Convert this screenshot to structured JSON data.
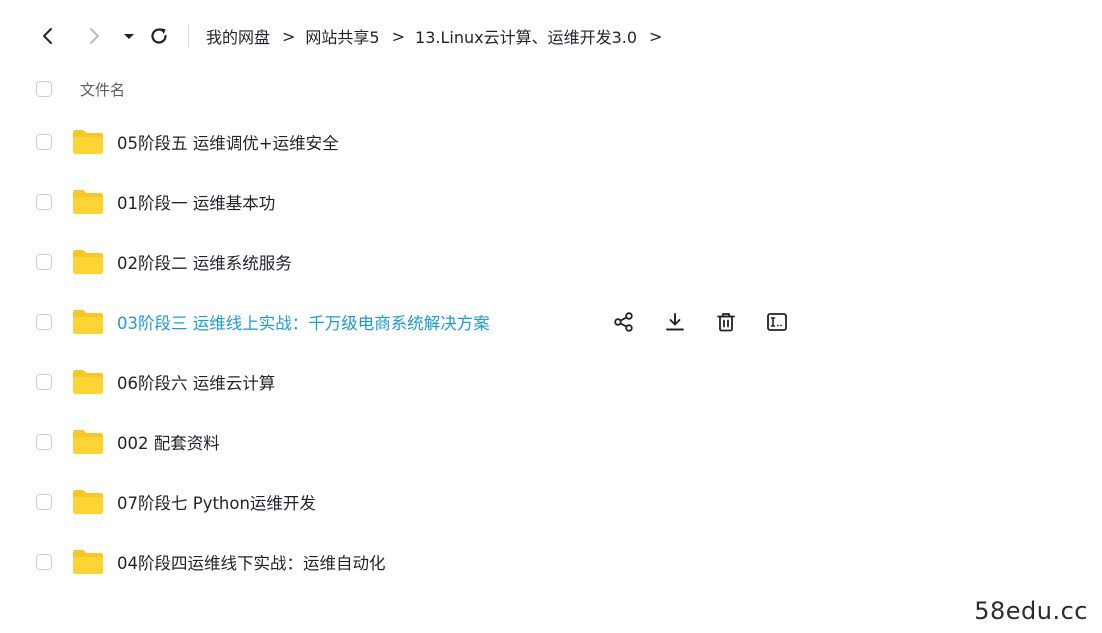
{
  "breadcrumb": [
    "我的网盘",
    "网站共享5",
    "13.Linux云计算、运维开发3.0"
  ],
  "breadcrumb_separator": ">",
  "list_header": {
    "name_column": "文件名"
  },
  "files": [
    {
      "name": "05阶段五 运维调优+运维安全",
      "type": "folder",
      "hovered": false
    },
    {
      "name": "01阶段一 运维基本功",
      "type": "folder",
      "hovered": false
    },
    {
      "name": "02阶段二 运维系统服务",
      "type": "folder",
      "hovered": false
    },
    {
      "name": "03阶段三 运维线上实战：千万级电商系统解决方案",
      "type": "folder",
      "hovered": true
    },
    {
      "name": "06阶段六 运维云计算",
      "type": "folder",
      "hovered": false
    },
    {
      "name": "002 配套资料",
      "type": "folder",
      "hovered": false
    },
    {
      "name": "07阶段七 Python运维开发",
      "type": "folder",
      "hovered": false
    },
    {
      "name": "04阶段四运维线下实战：运维自动化",
      "type": "folder",
      "hovered": false
    }
  ],
  "row_actions": [
    "share-icon",
    "download-icon",
    "delete-icon",
    "rename-icon"
  ],
  "icons": {
    "back": "chevron-left-icon",
    "forward": "chevron-right-icon",
    "history": "caret-down-icon",
    "refresh": "refresh-icon",
    "folder": "folder-icon"
  },
  "colors": {
    "folder": "#f8c62b",
    "hover_text": "#1d9bd7",
    "text": "#1f2329",
    "muted": "#5a5f66"
  },
  "watermark": "58edu.cc"
}
